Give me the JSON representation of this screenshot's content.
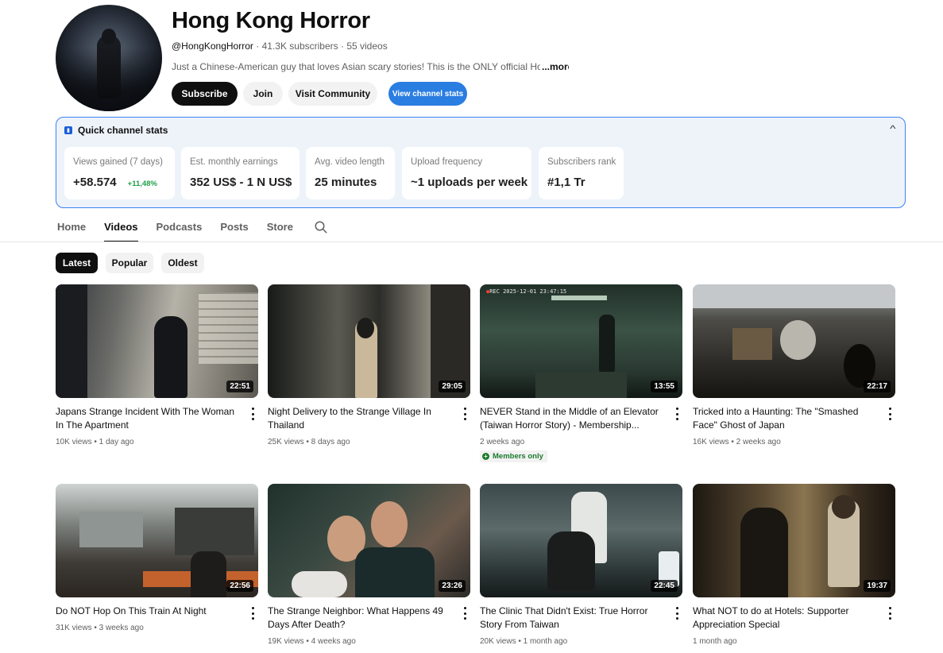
{
  "channel": {
    "name": "Hong Kong Horror",
    "handle": "@HongKongHorror",
    "subscribers": "41.3K subscribers",
    "video_count": "55 videos",
    "description": "Just a Chinese-American guy that loves Asian scary stories! This is the ONLY official Hon",
    "description_more": "...more"
  },
  "buttons": {
    "subscribe": "Subscribe",
    "join": "Join",
    "community": "Visit Community",
    "view_stats": "View channel stats"
  },
  "stats": {
    "title": "Quick channel stats",
    "icon": "chart-icon",
    "cards": [
      {
        "label": "Views gained (7 days)",
        "value": "+58.574",
        "delta": "+11,48%"
      },
      {
        "label": "Est. monthly earnings",
        "value": "352 US$ - 1 N US$"
      },
      {
        "label": "Avg. video length",
        "value": "25 minutes"
      },
      {
        "label": "Upload frequency",
        "value": "~1 uploads per week"
      },
      {
        "label": "Subscribers rank",
        "value": "#1,1 Tr"
      }
    ],
    "delta_color": "#1e9e4a"
  },
  "tabs": [
    "Home",
    "Videos",
    "Podcasts",
    "Posts",
    "Store"
  ],
  "active_tab": "Videos",
  "chips": [
    "Latest",
    "Popular",
    "Oldest"
  ],
  "active_chip": "Latest",
  "videos": [
    {
      "title": "Japans Strange Incident With The Woman In The Apartment",
      "meta": "10K views • 1 day ago",
      "duration": "22:51"
    },
    {
      "title": "Night Delivery to the Strange Village In Thailand",
      "meta": "25K views • 8 days ago",
      "duration": "29:05"
    },
    {
      "title": "NEVER Stand in the Middle of an Elevator (Taiwan Horror Story) - Membership...",
      "meta": "2 weeks ago",
      "duration": "13:55",
      "badge": "Members only",
      "overlay": "REC  2025-12-01  23:47:15"
    },
    {
      "title": "Tricked into a Haunting: The \"Smashed Face\" Ghost of Japan",
      "meta": "16K views • 2 weeks ago",
      "duration": "22:17"
    },
    {
      "title": "Do NOT Hop On This Train At Night",
      "meta": "31K views • 3 weeks ago",
      "duration": "22:56"
    },
    {
      "title": "The Strange Neighbor: What Happens 49 Days After Death?",
      "meta": "19K views • 4 weeks ago",
      "duration": "23:26"
    },
    {
      "title": "The Clinic That Didn't Exist: True Horror Story From Taiwan",
      "meta": "20K views • 1 month ago",
      "duration": "22:45"
    },
    {
      "title": "What NOT to do at Hotels: Supporter Appreciation Special",
      "meta": "1 month ago",
      "duration": "19:37"
    }
  ],
  "colors": {
    "accent_blue": "#2a7de1",
    "panel_border": "#3b82f6",
    "members_green": "#1b7b2d"
  }
}
